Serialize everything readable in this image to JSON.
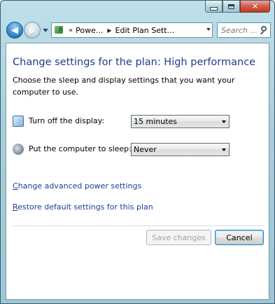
{
  "window": {
    "caption_buttons": {
      "minimize": "minimize-icon",
      "maximize": "maximize-icon",
      "close": "close-icon"
    }
  },
  "navigation": {
    "back_icon": "back-arrow-icon",
    "forward_icon": "forward-arrow-icon",
    "address_icon": "power-options-icon",
    "chevron": "«",
    "breadcrumbs": [
      "Powe...",
      "Edit Plan Sett..."
    ],
    "separator_glyph": "▶",
    "search_placeholder": "Search ..."
  },
  "main": {
    "title": "Change settings for the plan: High performance",
    "description": "Choose the sleep and display settings that you want your computer to use.",
    "settings": [
      {
        "label": "Turn off the display:",
        "value": "15 minutes",
        "icon": "monitor-icon"
      },
      {
        "label": "Put the computer to sleep:",
        "value": "Never",
        "icon": "sleep-moon-icon"
      }
    ],
    "links": {
      "advanced_first": "C",
      "advanced_rest": "hange advanced power settings",
      "restore_first": "R",
      "restore_rest": "estore default settings for this plan"
    },
    "buttons": {
      "save": "Save changes",
      "cancel": "Cancel"
    }
  },
  "colors": {
    "title": "#1a3e8a",
    "link": "#1a3e9c",
    "frame": "#a7cfdb"
  }
}
